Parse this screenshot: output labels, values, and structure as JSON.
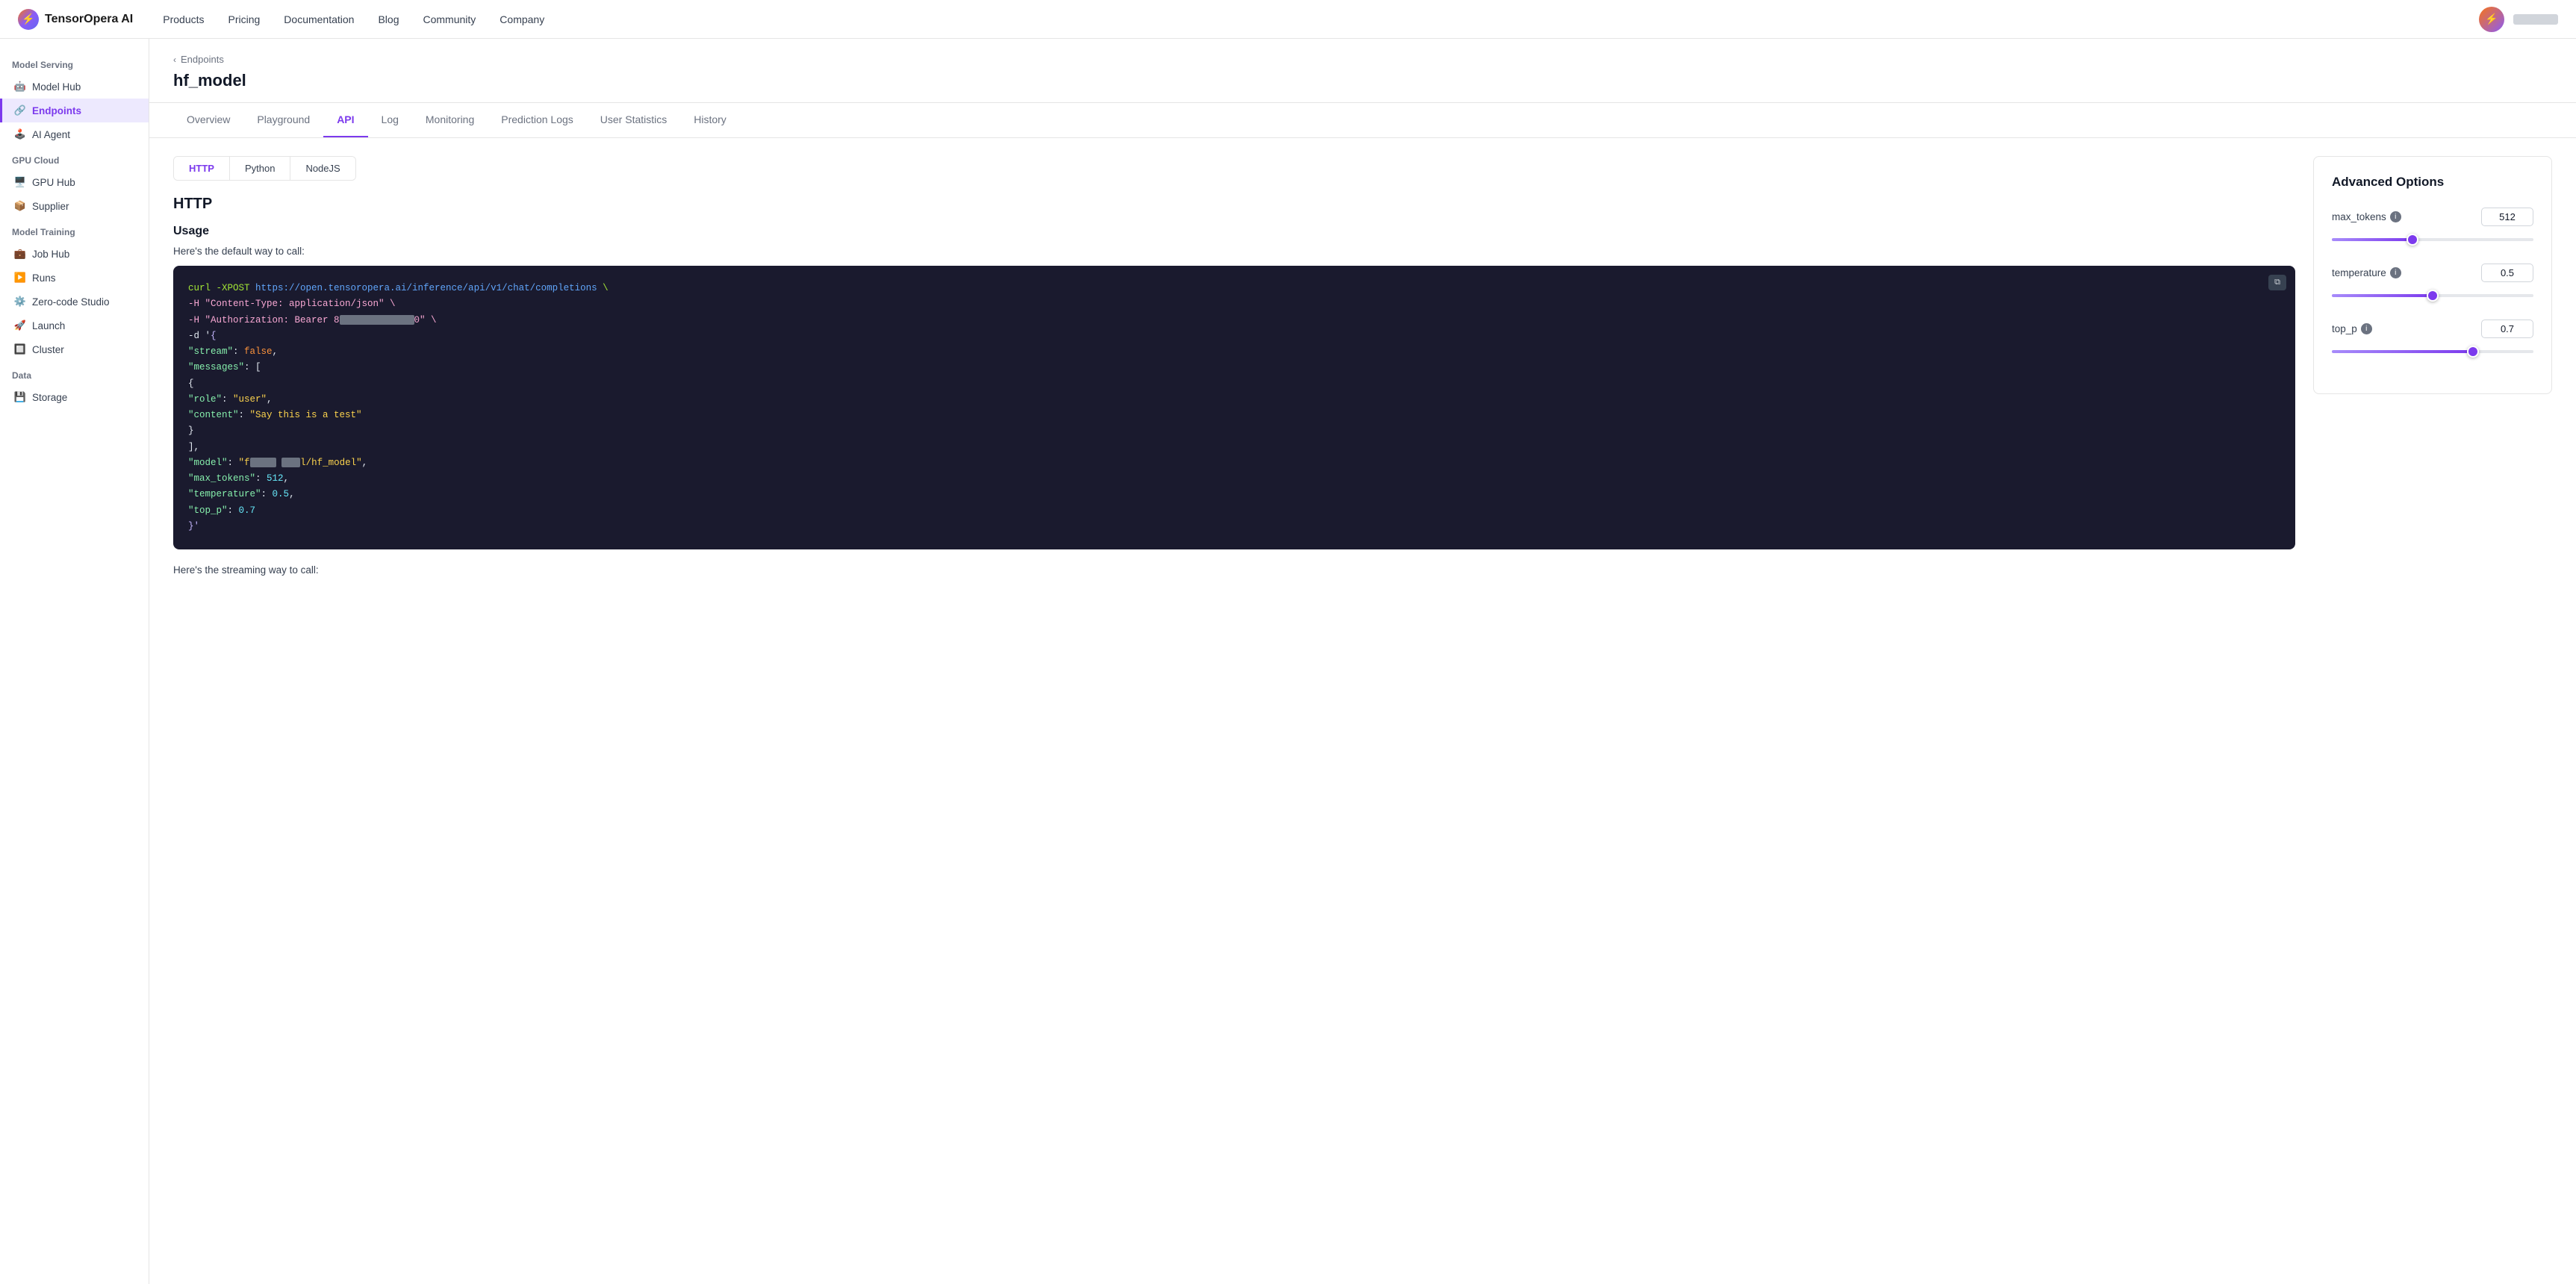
{
  "app": {
    "logo_text": "TensorOpera AI",
    "logo_emoji": "⚡"
  },
  "topnav": {
    "links": [
      "Products",
      "Pricing",
      "Documentation",
      "Blog",
      "Community",
      "Company"
    ]
  },
  "sidebar": {
    "sections": [
      {
        "label": "Model Serving",
        "items": [
          {
            "id": "model-hub",
            "label": "Model Hub",
            "icon": "🤖"
          },
          {
            "id": "endpoints",
            "label": "Endpoints",
            "icon": "🔗",
            "active": true
          },
          {
            "id": "ai-agent",
            "label": "AI Agent",
            "icon": "🕹️"
          }
        ]
      },
      {
        "label": "GPU Cloud",
        "items": [
          {
            "id": "gpu-hub",
            "label": "GPU Hub",
            "icon": "🖥️"
          },
          {
            "id": "supplier",
            "label": "Supplier",
            "icon": "📦"
          }
        ]
      },
      {
        "label": "Model Training",
        "items": [
          {
            "id": "job-hub",
            "label": "Job Hub",
            "icon": "💼"
          },
          {
            "id": "runs",
            "label": "Runs",
            "icon": "▶️"
          },
          {
            "id": "zero-code-studio",
            "label": "Zero-code Studio",
            "icon": "⚙️"
          },
          {
            "id": "launch",
            "label": "Launch",
            "icon": "🚀"
          },
          {
            "id": "cluster",
            "label": "Cluster",
            "icon": "🔲"
          }
        ]
      },
      {
        "label": "Data",
        "items": [
          {
            "id": "storage",
            "label": "Storage",
            "icon": "💾"
          }
        ]
      }
    ]
  },
  "page": {
    "breadcrumb": "Endpoints",
    "title": "hf_model"
  },
  "tabs": [
    {
      "id": "overview",
      "label": "Overview"
    },
    {
      "id": "playground",
      "label": "Playground"
    },
    {
      "id": "api",
      "label": "API",
      "active": true
    },
    {
      "id": "log",
      "label": "Log"
    },
    {
      "id": "monitoring",
      "label": "Monitoring"
    },
    {
      "id": "prediction-logs",
      "label": "Prediction Logs"
    },
    {
      "id": "user-statistics",
      "label": "User Statistics"
    },
    {
      "id": "history",
      "label": "History"
    }
  ],
  "subtabs": [
    {
      "id": "http",
      "label": "HTTP",
      "active": true
    },
    {
      "id": "python",
      "label": "Python"
    },
    {
      "id": "nodejs",
      "label": "NodeJS"
    }
  ],
  "code_section": {
    "title": "HTTP",
    "usage_title": "Usage",
    "usage_desc": "Here's the default way to call:",
    "streaming_desc": "Here's the streaming way to call:",
    "code_lines": [
      {
        "type": "cmd",
        "text": "curl -XPOST https://open.tensoropera.ai/inference/api/v1/chat/completions \\"
      },
      {
        "type": "flag",
        "text": "  -H \"Content-Type: application/json\" \\"
      },
      {
        "type": "flag_blur",
        "text": "  -H \"Authorization: Bearer 8",
        "blur_width": 120,
        "tail": "0\" \\"
      },
      {
        "type": "data_start",
        "text": "  -d '{"
      },
      {
        "type": "kv",
        "key": "\"stream\"",
        "val": "false,"
      },
      {
        "type": "kv",
        "key": "\"messages\"",
        "val": "["
      },
      {
        "type": "obj_start",
        "text": "    {"
      },
      {
        "type": "kv2",
        "key": "\"role\"",
        "val": "\"user\","
      },
      {
        "type": "kv2",
        "key": "\"content\"",
        "val": "\"Say this is a test\""
      },
      {
        "type": "obj_end",
        "text": "    }"
      },
      {
        "type": "arr_end",
        "text": "  ],"
      },
      {
        "type": "model_line",
        "text_pre": "\"model\": \"f",
        "blur1": 40,
        "blur2": 30,
        "text_post": "l/hf_model\","
      },
      {
        "type": "kv",
        "key": "\"max_tokens\"",
        "val": "512,"
      },
      {
        "type": "kv",
        "key": "\"temperature\"",
        "val": "0.5,"
      },
      {
        "type": "kv",
        "key": "\"top_p\"",
        "val": "0.7"
      },
      {
        "type": "end",
        "text": "}'"
      }
    ]
  },
  "advanced": {
    "title": "Advanced Options",
    "options": [
      {
        "id": "max_tokens",
        "label": "max_tokens",
        "value": "512",
        "fill_pct": 40,
        "thumb_pct": 40
      },
      {
        "id": "temperature",
        "label": "temperature",
        "value": "0.5",
        "fill_pct": 50,
        "thumb_pct": 50
      },
      {
        "id": "top_p",
        "label": "top_p",
        "value": "0.7",
        "fill_pct": 70,
        "thumb_pct": 70
      }
    ]
  },
  "copy_button_label": "⧉"
}
